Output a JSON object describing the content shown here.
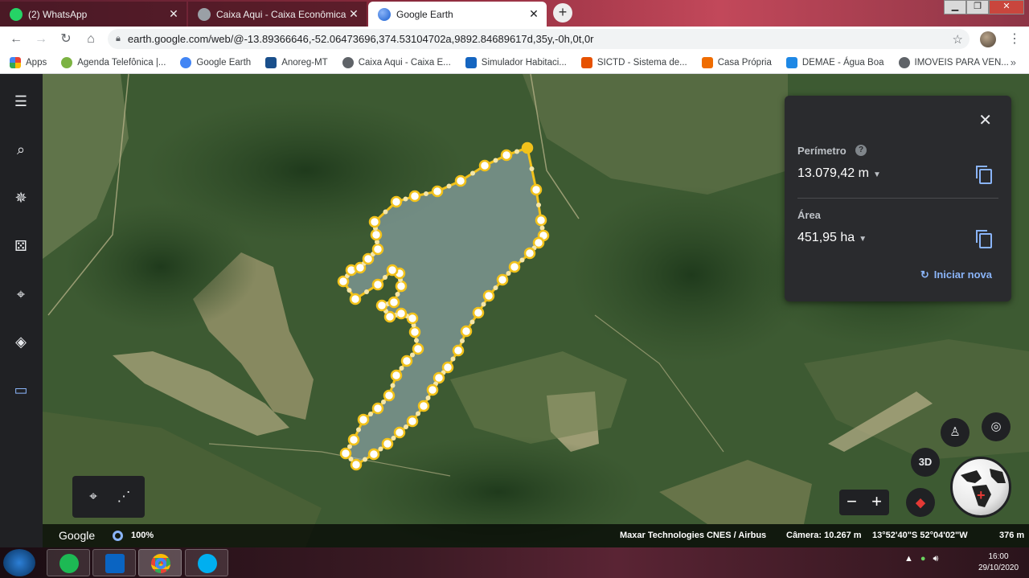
{
  "browser": {
    "tabs": [
      {
        "title": "(2) WhatsApp",
        "favicon_color": "#25d366",
        "active": false
      },
      {
        "title": "Caixa Aqui - Caixa Econômica Fe",
        "favicon_color": "#9aa0a6",
        "active": false
      },
      {
        "title": "Google Earth",
        "favicon_color": "#4285f4",
        "active": true
      }
    ],
    "new_tab_label": "+",
    "url": "earth.google.com/web/@-13.89366646,-52.06473696,374.53104702a,9892.84689617d,35y,-0h,0t,0r",
    "bookmarks": [
      {
        "label": "Apps",
        "color": "#ea4335"
      },
      {
        "label": "Agenda Telefônica |...",
        "color": "#7cb342"
      },
      {
        "label": "Google Earth",
        "color": "#4285f4"
      },
      {
        "label": "Anoreg-MT",
        "color": "#1a4f8b"
      },
      {
        "label": "Caixa Aqui - Caixa E...",
        "color": "#5f6368"
      },
      {
        "label": "Simulador Habitaci...",
        "color": "#1565c0"
      },
      {
        "label": "SICTD - Sistema de...",
        "color": "#e65100"
      },
      {
        "label": "Casa Própria",
        "color": "#ef6c00"
      },
      {
        "label": "DEMAE - Água Boa",
        "color": "#1e88e5"
      },
      {
        "label": "IMOVEIS PARA VEN...",
        "color": "#5f6368"
      }
    ],
    "bookmarks_more": "»"
  },
  "rail": {
    "items": [
      {
        "name": "menu",
        "glyph": "☰"
      },
      {
        "name": "search",
        "glyph": "⌕"
      },
      {
        "name": "voyager",
        "glyph": "✵"
      },
      {
        "name": "feeling-lucky",
        "glyph": "⚄"
      },
      {
        "name": "projects",
        "glyph": "⌖"
      },
      {
        "name": "map-style",
        "glyph": "◈"
      },
      {
        "name": "measure",
        "glyph": "▭"
      }
    ]
  },
  "measure_panel": {
    "perimeter_label": "Perímetro",
    "perimeter_value": "13.079,42 m",
    "area_label": "Área",
    "area_value": "451,95 ha",
    "restart_label": "Iniciar nova",
    "help_glyph": "?",
    "close_glyph": "✕",
    "caret_glyph": "▼",
    "accent_color": "#8ab4f8"
  },
  "map_controls": {
    "three_d_label": "3D",
    "zoom_out": "−",
    "zoom_in": "+"
  },
  "status_bar": {
    "google_label": "Google",
    "loading_percent": "100%",
    "attribution": "Maxar Technologies  CNES / Airbus",
    "camera": "Câmera: 10.267 m",
    "coordinates": "13°52'40\"S 52°04'02\"W",
    "scale": "376 m"
  },
  "polygon": {
    "stroke_color": "#f2c21b",
    "fill_color": "#9fb6c4"
  },
  "taskbar": {
    "time": "16:00",
    "date": "29/10/2020"
  }
}
